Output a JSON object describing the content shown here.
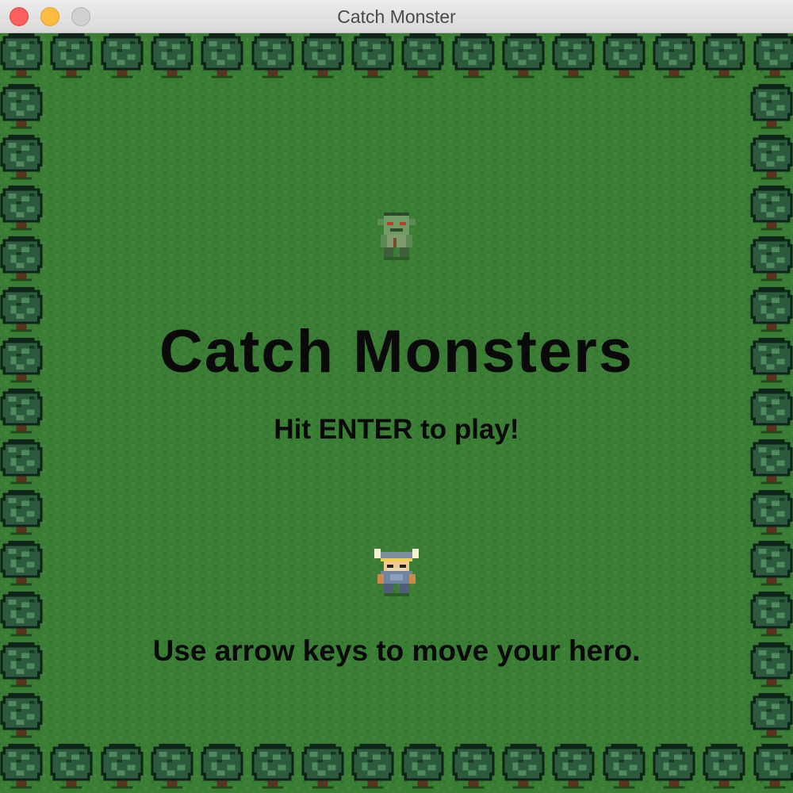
{
  "window": {
    "title": "Catch Monster"
  },
  "game": {
    "title": "Catch Monsters",
    "start_prompt": "Hit ENTER to play!",
    "controls_hint": "Use arrow keys to move your hero."
  },
  "sprites": {
    "monster": "goblin-monster",
    "hero": "horned-helmet-hero",
    "border": "tree"
  },
  "colors": {
    "grass": "#3a7d34",
    "tree_leaves": "#1f4a2c",
    "text": "#0a0a0a"
  }
}
